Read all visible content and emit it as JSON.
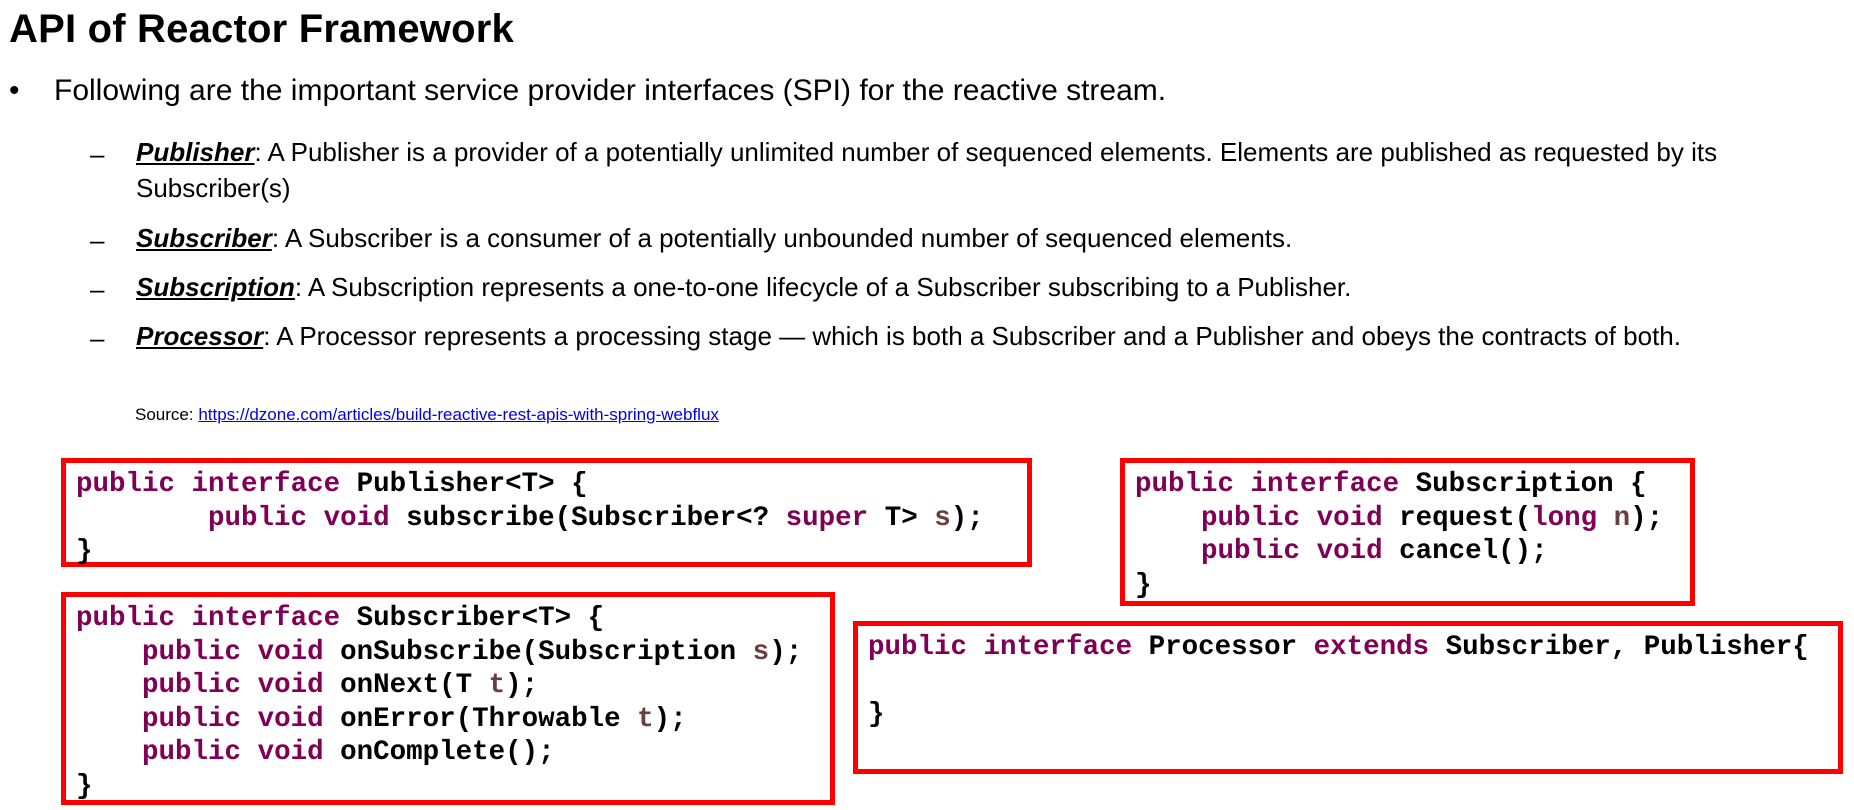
{
  "title": "API of Reactor Framework",
  "bullet_symbol": "•",
  "dash_symbol": "–",
  "intro": "Following are the important service provider interfaces (SPI) for the reactive stream.",
  "items": [
    {
      "term": "Publisher",
      "desc": ": A Publisher is a provider of a potentially unlimited number of sequenced elements. Elements are published as requested by its Subscriber(s)"
    },
    {
      "term": "Subscriber",
      "desc": ": A Subscriber is a consumer of a potentially unbounded number of sequenced elements."
    },
    {
      "term": "Subscription",
      "desc": ": A Subscription represents a one-to-one lifecycle of a Subscriber subscribing to a Publisher."
    },
    {
      "term": "Processor",
      "desc": ": A Processor represents a processing stage — which is both a Subscriber and a Publisher and obeys the contracts of both."
    }
  ],
  "source": {
    "label": "Source: ",
    "url_text": "https://dzone.com/articles/build-reactive-rest-apis-with-spring-webflux"
  },
  "colors": {
    "keyword": "#7f0055",
    "param": "#6a3e3e",
    "box_border": "#ff0000",
    "link": "#0000ee"
  },
  "code": {
    "kw_public": "public",
    "kw_interface": "interface",
    "kw_void": "void",
    "kw_super": "super",
    "kw_long": "long",
    "kw_extends": "extends",
    "publisher": {
      "name": "Publisher<T> {",
      "method": "subscribe(Subscriber<? ",
      "type_end": "T> ",
      "param": "s",
      "end": ");",
      "close": "}"
    },
    "subscription": {
      "name": "Subscription {",
      "m1": "request(",
      "m1_param": "n",
      "m1_end": ");",
      "m2": "cancel();",
      "close": "}"
    },
    "subscriber": {
      "name": "Subscriber<T> {",
      "m1": "onSubscribe(Subscription ",
      "m1_param": "s",
      "m1_end": ");",
      "m2": "onNext(T ",
      "m2_param": "t",
      "m2_end": ");",
      "m3": "onError(Throwable ",
      "m3_param": "t",
      "m3_end": ");",
      "m4": "onComplete();",
      "close": "}"
    },
    "processor": {
      "name": "Processor ",
      "supers": "Subscriber, Publisher{",
      "close": "}"
    }
  }
}
